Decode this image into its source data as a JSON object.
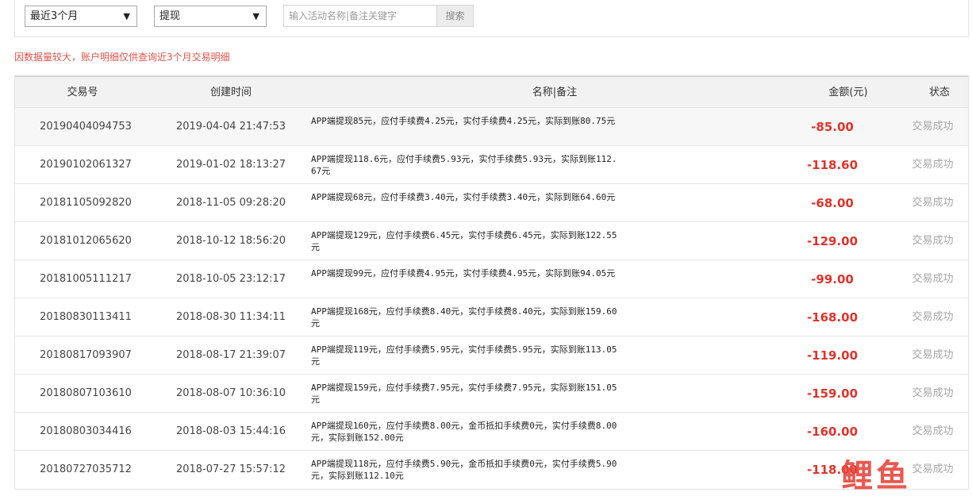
{
  "filters": {
    "range": {
      "selected": "最近3个月"
    },
    "type": {
      "selected": "提现"
    },
    "search": {
      "placeholder": "输入活动名称|备注关键字",
      "button_label": "搜索"
    }
  },
  "notice": "因数据量较大，账户明细仅供查询近3个月交易明细",
  "table": {
    "headers": {
      "id": "交易号",
      "time": "创建时间",
      "note": "名称|备注",
      "amount": "金额(元)",
      "status": "状态"
    },
    "rows": [
      {
        "id": "20190404094753",
        "time": "2019-04-04 21:47:53",
        "note": "APP端提现85元，应付手续费4.25元，实付手续费4.25元，实际到账80.75元",
        "amount": "-85.00",
        "status": "交易成功"
      },
      {
        "id": "20190102061327",
        "time": "2019-01-02 18:13:27",
        "note": "APP端提现118.6元，应付手续费5.93元，实付手续费5.93元，实际到账112.67元",
        "amount": "-118.60",
        "status": "交易成功"
      },
      {
        "id": "20181105092820",
        "time": "2018-11-05 09:28:20",
        "note": "APP端提现68元，应付手续费3.40元，实付手续费3.40元，实际到账64.60元",
        "amount": "-68.00",
        "status": "交易成功"
      },
      {
        "id": "20181012065620",
        "time": "2018-10-12 18:56:20",
        "note": "APP端提现129元，应付手续费6.45元，实付手续费6.45元，实际到账122.55元",
        "amount": "-129.00",
        "status": "交易成功"
      },
      {
        "id": "20181005111217",
        "time": "2018-10-05 23:12:17",
        "note": "APP端提现99元，应付手续费4.95元，实付手续费4.95元，实际到账94.05元",
        "amount": "-99.00",
        "status": "交易成功"
      },
      {
        "id": "20180830113411",
        "time": "2018-08-30 11:34:11",
        "note": "APP端提现168元，应付手续费8.40元，实付手续费8.40元，实际到账159.60元",
        "amount": "-168.00",
        "status": "交易成功"
      },
      {
        "id": "20180817093907",
        "time": "2018-08-17 21:39:07",
        "note": "APP端提现119元，应付手续费5.95元，实付手续费5.95元，实际到账113.05元",
        "amount": "-119.00",
        "status": "交易成功"
      },
      {
        "id": "20180807103610",
        "time": "2018-08-07 10:36:10",
        "note": "APP端提现159元，应付手续费7.95元，实付手续费7.95元，实际到账151.05元",
        "amount": "-159.00",
        "status": "交易成功"
      },
      {
        "id": "20180803034416",
        "time": "2018-08-03 15:44:16",
        "note": "APP端提现160元，应付手续费8.00元，金币抵扣手续费0元，实付手续费8.00元，实际到账152.00元",
        "amount": "-160.00",
        "status": "交易成功"
      },
      {
        "id": "20180727035712",
        "time": "2018-07-27 15:57:12",
        "note": "APP端提现118元，应付手续费5.90元，金币抵扣手续费0元，实付手续费5.90元，实际到账112.10元",
        "amount": "-118.00",
        "status": "交易成功"
      }
    ]
  },
  "watermark": "鲤鱼",
  "colors": {
    "amount": "#e0332c",
    "notice": "#e4514a",
    "status": "#a5a5a5"
  }
}
